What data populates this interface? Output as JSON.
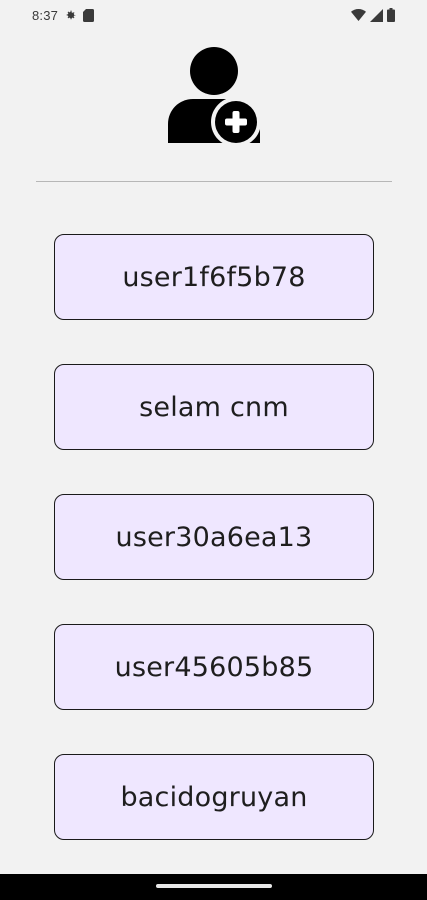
{
  "status_bar": {
    "time": "8:37",
    "icons": [
      "settings-icon",
      "sim-card-icon",
      "wifi-icon",
      "cellular-signal-icon",
      "battery-icon"
    ]
  },
  "header": {
    "icon": "add-user-icon"
  },
  "users": [
    {
      "label": "user1f6f5b78"
    },
    {
      "label": "selam cnm"
    },
    {
      "label": "user30a6ea13"
    },
    {
      "label": "user45605b85"
    },
    {
      "label": "bacidogruyan"
    }
  ],
  "colors": {
    "background": "#f2f2f2",
    "button_fill": "#efe7ff",
    "button_border": "#1a1a1a",
    "nav_bar": "#000000"
  }
}
